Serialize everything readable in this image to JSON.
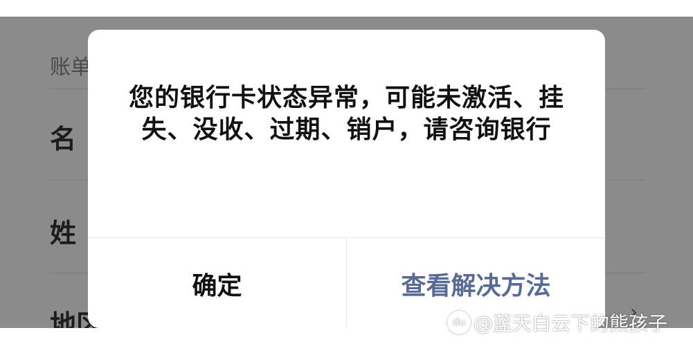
{
  "background": {
    "section_label": "账单",
    "row_labels": [
      "名",
      "姓",
      "地区"
    ],
    "chevron_icon": "chevron-right-icon"
  },
  "dialog": {
    "message": "您的银行卡状态异常，可能未激活、挂失、没收、过期、销户，请咨询银行",
    "confirm_label": "确定",
    "solutions_label": "查看解决方法",
    "link_color": "#576b95"
  },
  "watermark": {
    "icon": "baidu-paw-icon",
    "text": "@蓝天白云下的熊孩子"
  }
}
